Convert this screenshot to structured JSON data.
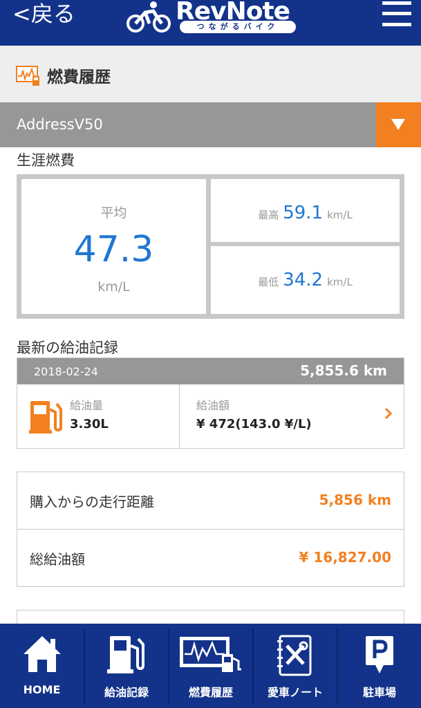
{
  "header": {
    "back_label": "<戻る",
    "logo_text": "RevNote",
    "logo_tagline": "つながるバイク"
  },
  "page": {
    "title": "燃費履歴"
  },
  "vehicle": {
    "selected": "AddressV50"
  },
  "lifetime": {
    "section_label": "生涯燃費",
    "avg_label": "平均",
    "avg_value": "47.3",
    "avg_unit": "km/L",
    "max_label": "最高",
    "max_value": "59.1",
    "max_unit": "km/L",
    "min_label": "最低",
    "min_value": "34.2",
    "min_unit": "km/L"
  },
  "latest_refuel": {
    "section_label": "最新の給油記録",
    "date": "2018-02-24",
    "odometer": "5,855.6 km",
    "quantity_label": "給油量",
    "quantity_value": "3.30L",
    "amount_label": "給油額",
    "amount_value": "¥ 472(143.0 ¥/L)"
  },
  "summary": [
    {
      "label": "購入からの走行距離",
      "value": "5,856 km"
    },
    {
      "label": "総給油額",
      "value": "¥ 16,827.00"
    }
  ],
  "nav": [
    {
      "label": "HOME",
      "icon": "home-icon"
    },
    {
      "label": "給油記録",
      "icon": "fuel-pump-icon"
    },
    {
      "label": "燃費履歴",
      "icon": "fuel-chart-icon"
    },
    {
      "label": "愛車ノート",
      "icon": "tools-notebook-icon"
    },
    {
      "label": "駐車場",
      "icon": "parking-icon"
    }
  ],
  "colors": {
    "brand_blue": "#13338a",
    "accent_orange": "#f28020",
    "value_blue": "#1f76d2",
    "bar_gray": "#979797"
  }
}
